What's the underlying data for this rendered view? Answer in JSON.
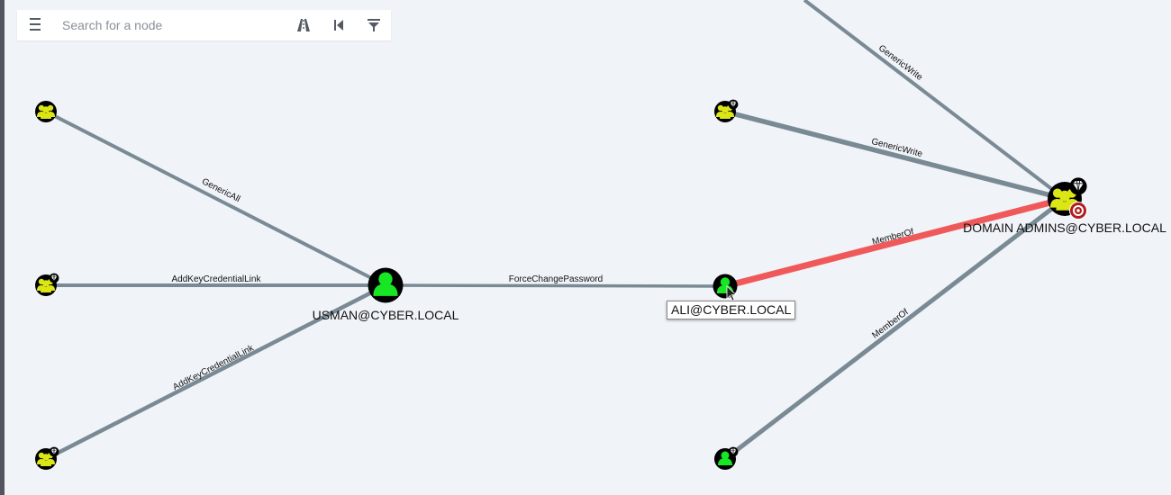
{
  "search": {
    "placeholder": "Search for a node"
  },
  "toolbar": {
    "menu_icon": "hamburger-menu-icon",
    "pathfinding_icon": "pathfinding-icon",
    "back_icon": "skip-back-icon",
    "filter_icon": "filter-icon"
  },
  "colors": {
    "background": "#f0f4f9",
    "edge": "#7a8a94",
    "highlight_edge": "#f0595a",
    "user_node": "#17e625",
    "group_node": "#dbe617",
    "node_circle": "#000000",
    "target_badge": "#b01d1d"
  },
  "nodes": {
    "usman": {
      "label": "USMAN@CYBER.LOCAL",
      "type": "user"
    },
    "ali": {
      "label": "ALI@CYBER.LOCAL",
      "type": "user"
    },
    "domain_admins": {
      "label": "DOMAIN ADMINS@CYBER.LOCAL",
      "type": "group",
      "badges": [
        "high-value-gem-icon",
        "target-icon"
      ]
    },
    "group_left_top": {
      "label": "",
      "type": "group"
    },
    "group_left_mid": {
      "label": "",
      "type": "group",
      "badges": [
        "high-value-gem-icon"
      ]
    },
    "group_left_bottom": {
      "label": "",
      "type": "group",
      "badges": [
        "high-value-gem-icon"
      ]
    },
    "group_mid_top": {
      "label": "",
      "type": "group",
      "badges": [
        "high-value-gem-icon"
      ]
    },
    "user_mid_bottom": {
      "label": "",
      "type": "user",
      "badges": [
        "high-value-gem-icon"
      ]
    }
  },
  "edges": {
    "e1": "GenericAll",
    "e2": "AddKeyCredentialLink",
    "e3": "AddKeyCredentialLink",
    "e4": "ForceChangePassword",
    "e5": "MemberOf",
    "e6": "GenericWrite",
    "e7": "GenericWrite",
    "e8": "MemberOf"
  }
}
